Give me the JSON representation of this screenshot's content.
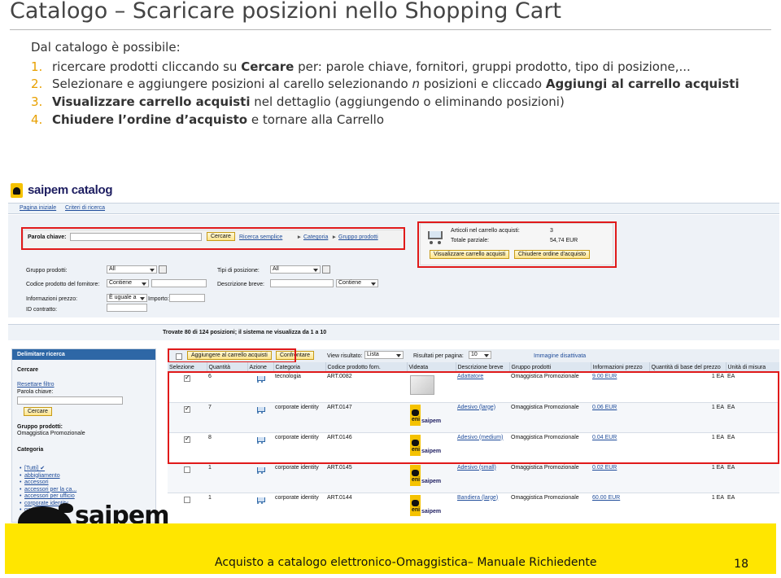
{
  "slide": {
    "title": "Catalogo – Scaricare posizioni nello Shopping Cart",
    "intro": "Dal catalogo è possibile:",
    "steps": [
      {
        "num": "1.",
        "pre": "ricercare prodotti cliccando su ",
        "bold": "Cercare",
        "post": " per: parole chiave, fornitori, gruppi prodotto, tipo di posizione,..."
      },
      {
        "num": "2.",
        "pre": "Selezionare e aggiungere posizioni al carello selezionando ",
        "italic": "n",
        "mid": " posizioni e cliccado ",
        "bold": "Aggiungi al carrello acquisti",
        "post": ""
      },
      {
        "num": "3.",
        "bold": "Visualizzare carrello acquisti",
        "post": " nel dettaglio (aggiungendo o eliminando posizioni)"
      },
      {
        "num": "4.",
        "bold": "Chiudere l’ordine d’acquisto",
        "post": " e tornare alla Carrello"
      }
    ],
    "footer_text": "Acquisto a catalogo elettronico-Omaggistica– Manuale Richiedente",
    "page_number": "18",
    "logo_text": "saipem"
  },
  "app": {
    "brand": "saipem catalog",
    "nav": [
      "Pagina iniziale",
      "Criteri di ricerca"
    ],
    "search": {
      "keyword_label": "Parola chiave:",
      "search_button": "Cercare",
      "simple_search_link": "Ricerca semplice",
      "category_link": "Categoria",
      "product_group_link": "Gruppo prodotti"
    },
    "cart": {
      "items_label": "Articoli nel carrello acquisti:",
      "items_value": "3",
      "subtotal_label": "Totale parziale:",
      "subtotal_value": "54,74 EUR",
      "view_cart_button": "Visualizzare carrello acquisti",
      "close_order_button": "Chiudere ordine d'acquisto"
    },
    "filters": {
      "product_group_label": "Gruppo prodotti:",
      "product_group_value": "All",
      "item_type_label": "Tipi di posizione:",
      "item_type_value": "All",
      "supplier_code_label": "Codice prodotto del fornitore:",
      "supplier_code_op": "Contiene",
      "short_desc_label": "Descrizione breve:",
      "short_desc_op": "Contiene",
      "price_info_label": "Informazioni prezzo:",
      "price_op": "È uguale a",
      "amount_label": "Importo:",
      "contract_label": "ID contratto:"
    },
    "results_text": "Trovate 80 di 124 posizioni; il sistema ne visualizza da 1 a 10",
    "left_panel": {
      "header": "Delimitare ricerca",
      "search_title": "Cercare",
      "reset_link": "Resettare filtro",
      "keyword_label": "Parola chiave:",
      "search_button": "Cercare",
      "group_title": "Gruppo prodotti:",
      "group_value": "Omaggistica Promozionale",
      "category_title": "Categoria",
      "categories": [
        "[Tutti] ✔",
        "abbigliamento",
        "accessori",
        "accessori per la ca...",
        "accessori per ufficio",
        "corporate identity",
        "gadget"
      ]
    },
    "toolbar": {
      "add_button": "Aggiungere al carrello acquisti",
      "compare_button": "Confrontare",
      "view_label": "View risultato:",
      "view_value": "Lista",
      "per_page_label": "Risultati per pagina:",
      "per_page_value": "10",
      "image_label": "Immagine disattivata"
    },
    "table": {
      "headers": [
        "Selezione",
        "Quantità",
        "Azione",
        "Categoria",
        "Codice prodotto forn.",
        "Videata",
        "Descrizione breve",
        "Gruppo prodotti",
        "Informazioni prezzo",
        "Quantità di base del prezzo",
        "Unità di misura"
      ],
      "rows": [
        {
          "checked": true,
          "qty": "6",
          "cat": "tecnologia",
          "code": "ART.0082",
          "img": "gadget",
          "desc": "Adattatore",
          "group": "Omaggistica Promozionale",
          "price": "9.00 EUR",
          "base": "1 EA",
          "unit": "EA"
        },
        {
          "checked": true,
          "qty": "7",
          "cat": "corporate identity",
          "code": "ART.0147",
          "img": "logo",
          "desc": "Adesivo (large)",
          "group": "Omaggistica Promozionale",
          "price": "0.06 EUR",
          "base": "1 EA",
          "unit": "EA"
        },
        {
          "checked": true,
          "qty": "8",
          "cat": "corporate identity",
          "code": "ART.0146",
          "img": "logo",
          "desc": "Adesivo (medium)",
          "group": "Omaggistica Promozionale",
          "price": "0.04 EUR",
          "base": "1 EA",
          "unit": "EA"
        },
        {
          "checked": false,
          "qty": "1",
          "cat": "corporate identity",
          "code": "ART.0145",
          "img": "logo",
          "desc": "Adesivo (small)",
          "group": "Omaggistica Promozionale",
          "price": "0.02 EUR",
          "base": "1 EA",
          "unit": "EA"
        },
        {
          "checked": false,
          "qty": "1",
          "cat": "corporate identity",
          "code": "ART.0144",
          "img": "logo",
          "desc": "Bandiera (large)",
          "group": "Omaggistica Promozionale",
          "price": "60.00 EUR",
          "base": "1 EA",
          "unit": "EA"
        }
      ],
      "logo_words": [
        "eni",
        "saipem"
      ]
    }
  },
  "colors": {
    "highlight": "#e01a1a",
    "accent": "#e8a000",
    "footer": "#ffe600",
    "link": "#1f4c9a"
  }
}
